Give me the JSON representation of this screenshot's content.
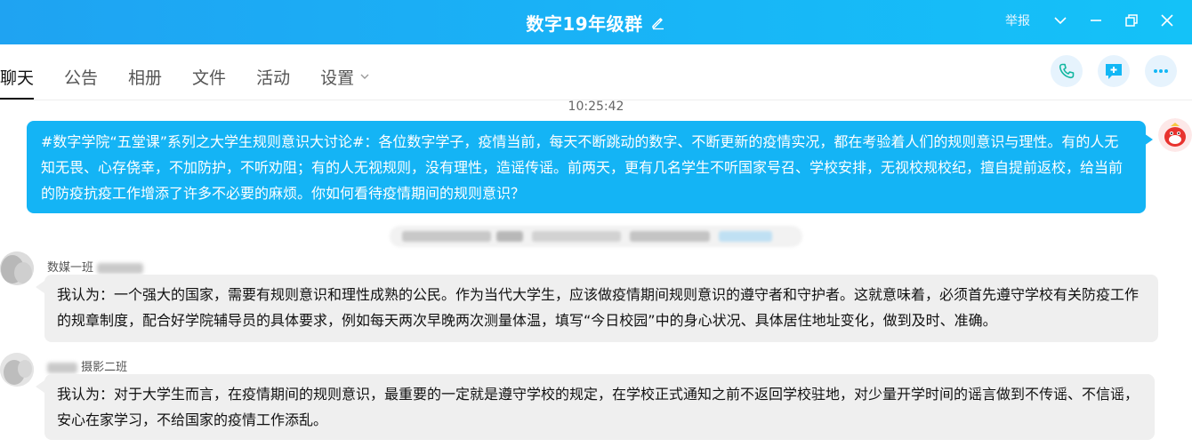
{
  "window": {
    "title": "数字19年级群",
    "report_label": "举报"
  },
  "tabs": [
    {
      "label": "聊天",
      "active": true
    },
    {
      "label": "公告"
    },
    {
      "label": "相册"
    },
    {
      "label": "文件"
    },
    {
      "label": "活动"
    },
    {
      "label": "设置"
    }
  ],
  "toolbar_icons": [
    "phone-icon",
    "add-message-icon",
    "more-icon"
  ],
  "chat": {
    "timestamp": "10:25:42",
    "own_message": {
      "text": "#数字学院“五堂课”系列之大学生规则意识大讨论#：各位数字学子，疫情当前，每天不断跳动的数字、不断更新的疫情实况，都在考验着人们的规则意识与理性。有的人无知无畏、心存侥幸，不加防护，不听劝阻；有的人无视规则，没有理性，造谣传谣。前两天，更有几名学生不听国家号召、学校安排，无视校规校纪，擅自提前返校，给当前的防疫抗疫工作增添了许多不必要的麻烦。你如何看待疫情期间的规则意识？"
    },
    "messages": [
      {
        "sender": "数媒一班",
        "text": "我认为：一个强大的国家，需要有规则意识和理性成熟的公民。作为当代大学生，应该做疫情期间规则意识的遵守者和守护者。这就意味着，必须首先遵守学校有关防疫工作的规章制度，配合好学院辅导员的具体要求，例如每天两次早晚两次测量体温，填写“今日校园”中的身心状况、具体居住地址变化，做到及时、准确。"
      },
      {
        "sender": "摄影二班",
        "text": "我认为：对于大学生而言，在疫情期间的规则意识，最重要的一定就是遵守学校的规定，在学校正式通知之前不返回学校驻地，对少量开学时间的谣言做到不传谣、不信谣，安心在家学习，不给国家的疫情工作添乱。"
      }
    ]
  },
  "colors": {
    "titlebar": "#1fa3f2",
    "own_bubble": "#14b4f5",
    "received_bubble": "#efefef",
    "icon_accent": "#12b7f5"
  }
}
